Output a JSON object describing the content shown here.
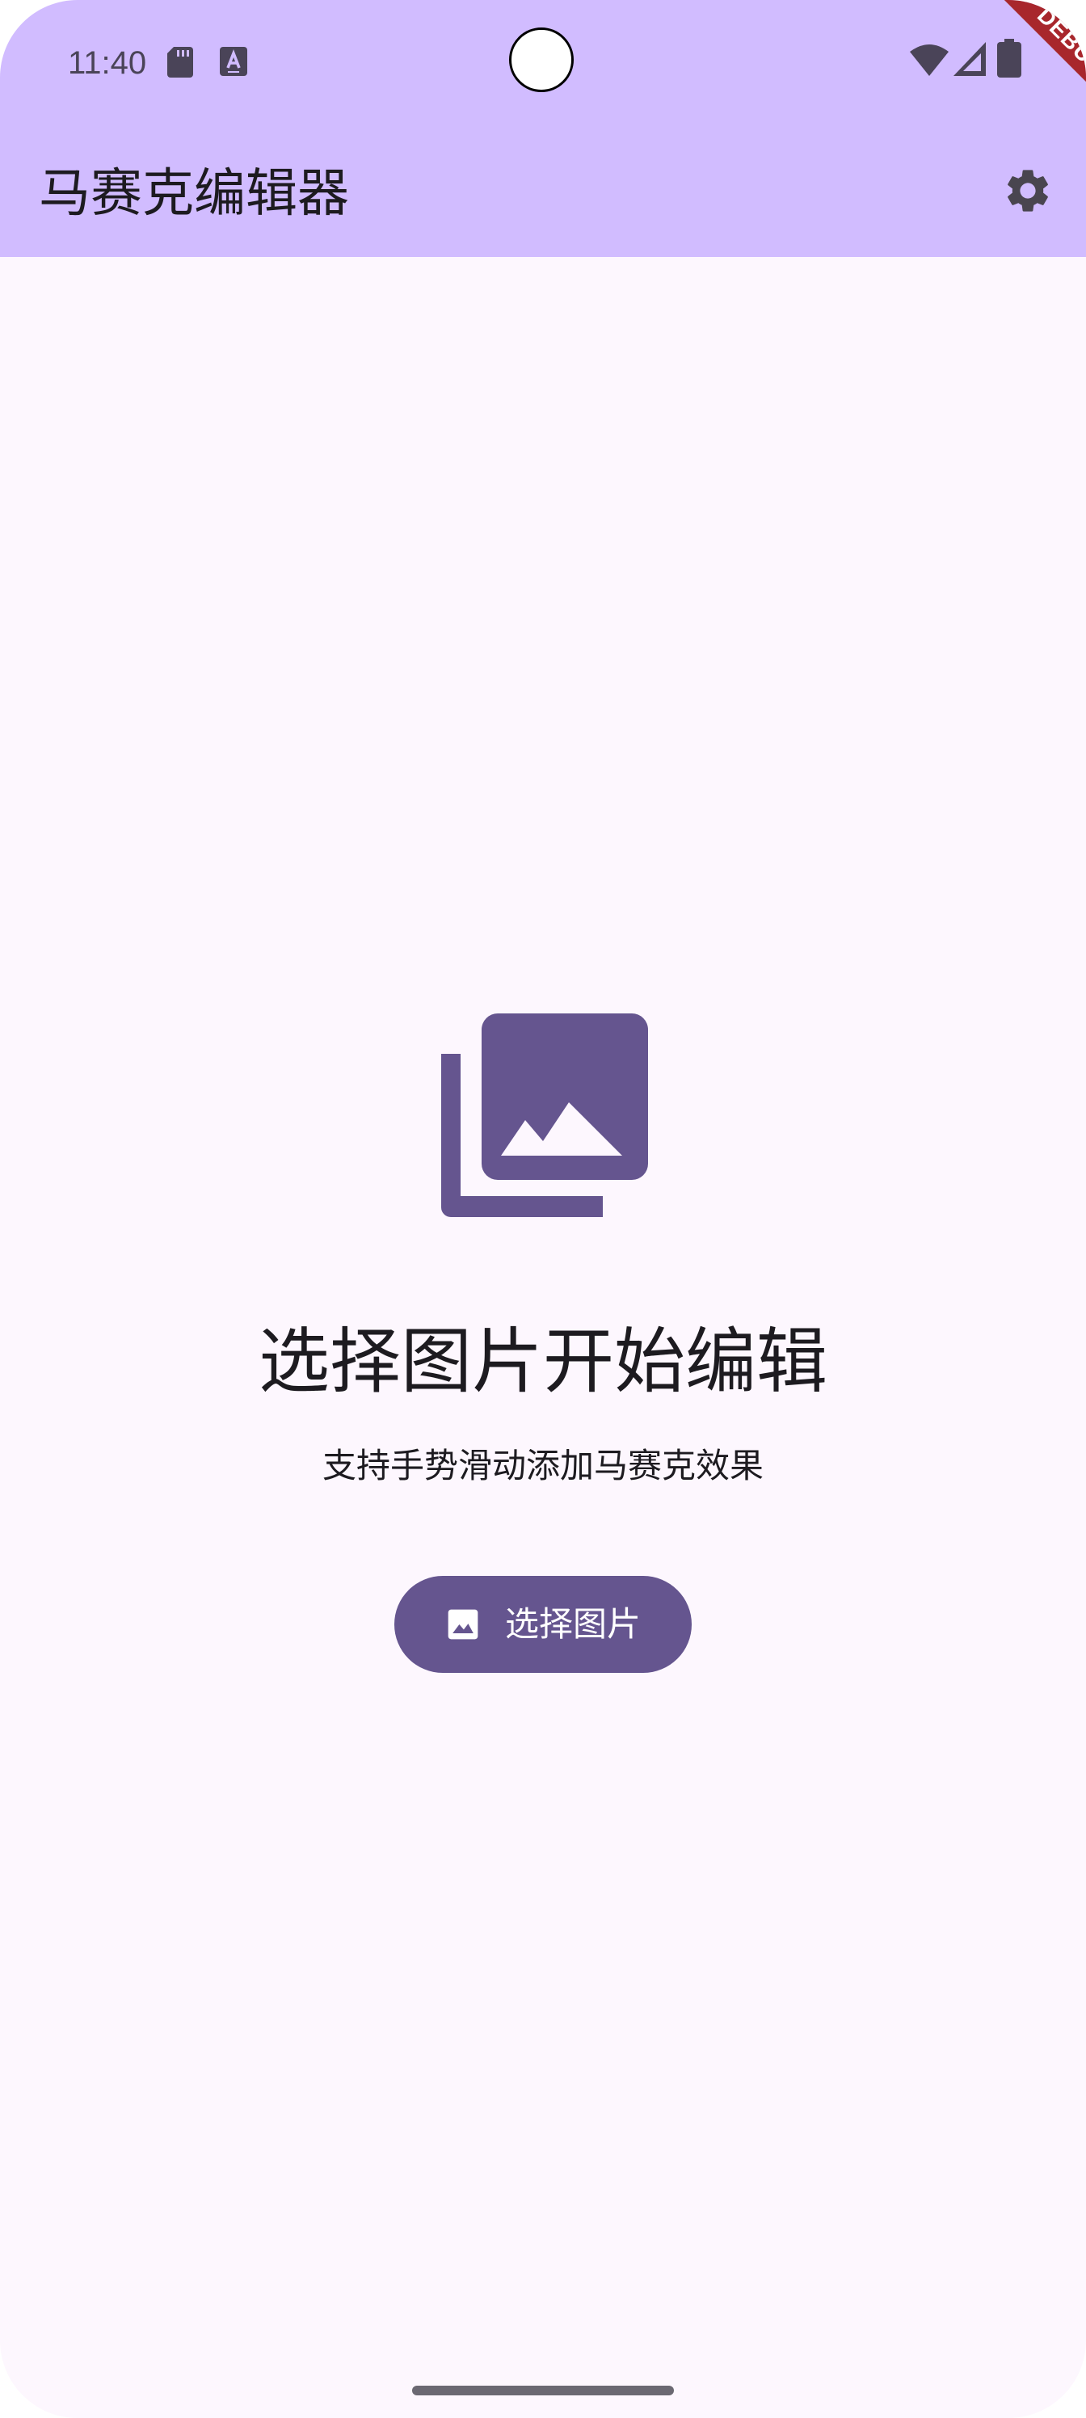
{
  "status_bar": {
    "time": "11:40",
    "icons": [
      "sd-card-icon",
      "a-accessibility-icon",
      "wifi-icon",
      "signal-icon",
      "battery-icon"
    ]
  },
  "debug_banner": "DEBUG",
  "app_bar": {
    "title": "马赛克编辑器",
    "action_icon": "settings-icon"
  },
  "main": {
    "illustration_icon": "photo-library-icon",
    "heading": "选择图片开始编辑",
    "subtitle": "支持手势滑动添加马赛克效果",
    "pick_button": {
      "icon": "image-icon",
      "label": "选择图片"
    }
  },
  "colors": {
    "app_bar_background": "#D1BCFF",
    "page_background": "#FDF7FE",
    "primary": "#65558F",
    "on_surface": "#1D1B20",
    "debug_banner": "#A8272C"
  }
}
